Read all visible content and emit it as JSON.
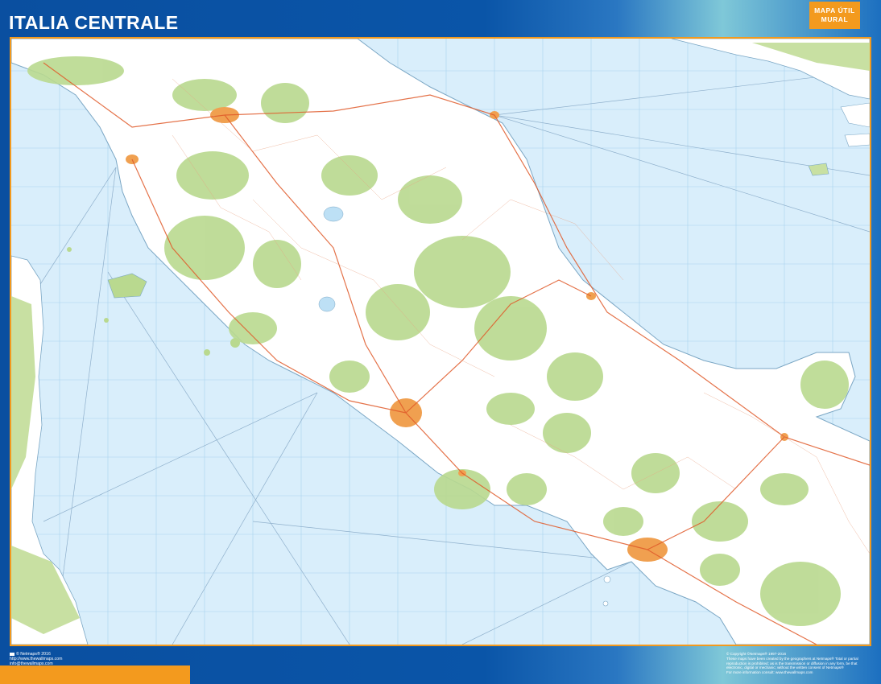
{
  "header": {
    "title": "ITALIA CENTRALE",
    "brand_line1": "MAPA ÚTIL",
    "brand_line2": "MURAL"
  },
  "footer": {
    "left_lines": [
      "© Netmaps® 2016",
      "http://www.thewallmaps.com",
      "info@thewallmaps.com"
    ],
    "right_lines": [
      "© Copyright ©Netmaps® 1997-2016",
      "These maps have been created by the geographers at Netmaps® Total or partial",
      "reproduction is prohibited; as is the transmission or diffusion in any form, be that",
      "electronic, digital or mechanic; without the written consent of Netmaps®",
      "For more information consult: www.thewallmaps.com"
    ]
  },
  "colors": {
    "frame_blue": "#0a4fa0",
    "accent_orange": "#f39a1e",
    "sea": "#d9eefb",
    "land": "#ffffff",
    "forest": "#b9d98f",
    "urban": "#f0a050",
    "roads": "#e05a2a"
  }
}
